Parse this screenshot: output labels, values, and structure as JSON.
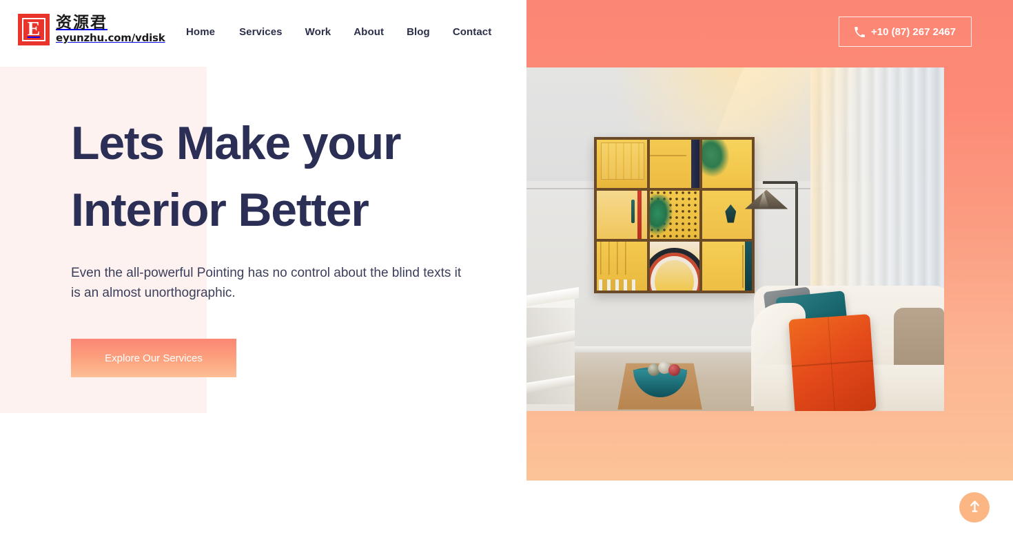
{
  "header": {
    "logo": {
      "mark_letter": "E",
      "chinese_name": "资源君",
      "url": "eyunzhu.com/vdisk"
    },
    "nav_items": [
      {
        "label": "Home"
      },
      {
        "label": "Services"
      },
      {
        "label": "Work"
      },
      {
        "label": "About"
      },
      {
        "label": "Blog"
      },
      {
        "label": "Contact"
      }
    ],
    "phone": {
      "icon": "phone-icon",
      "number": "+10 (87) 267 2467"
    }
  },
  "hero": {
    "headline_line1": "Lets Make your",
    "headline_line2": "Interior Better",
    "subtext": "Even the all-powerful Pointing has no control about the blind texts it is an almost unorthographic.",
    "cta_label": "Explore Our Services",
    "image_alt": "Modern living room with yellow framed photo grid, floor lamp, white sofa with teal and orange cushions, wooden coffee table with teal bowl"
  },
  "scroll_top": {
    "icon": "arrow-up-icon",
    "label": "Back to top"
  },
  "colors": {
    "coral_top": "#FC8675",
    "coral_bottom": "#FCC398",
    "headline_navy": "#2B2F55",
    "pink_block": "#FDF2EF",
    "logo_red": "#E8342A",
    "scroll_top_bg": "#FBB684"
  }
}
